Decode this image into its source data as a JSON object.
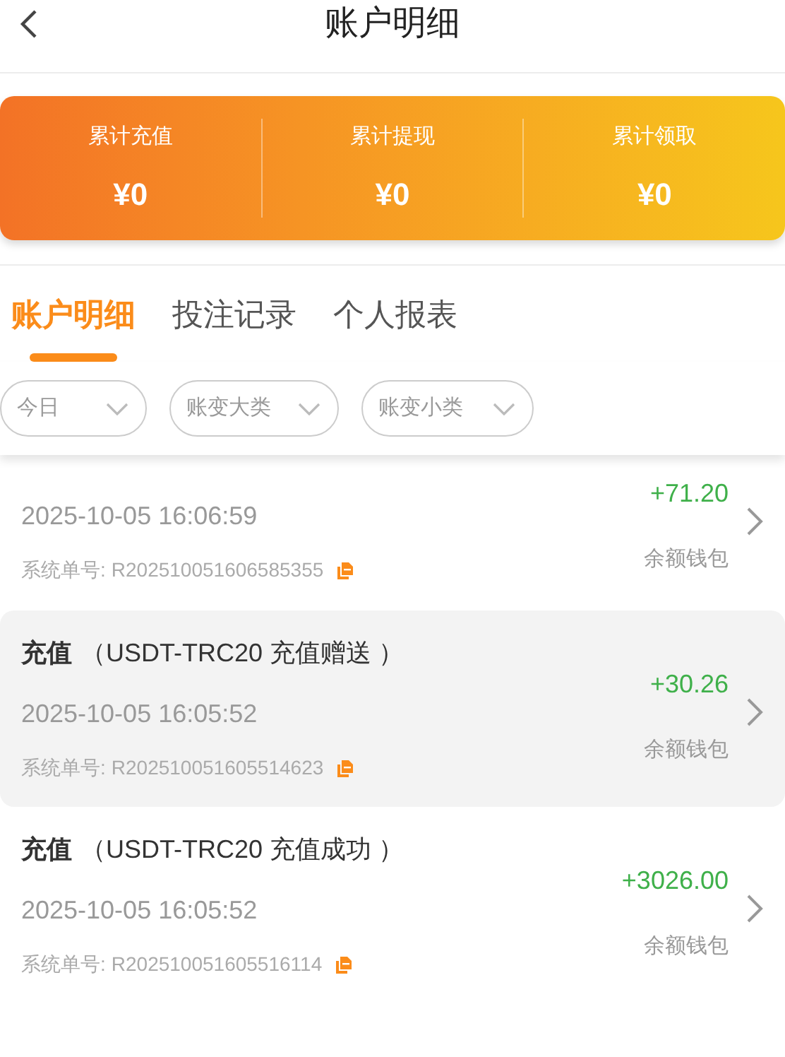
{
  "header": {
    "title": "账户明细"
  },
  "summary": [
    {
      "label": "累计充值",
      "value": "¥0"
    },
    {
      "label": "累计提现",
      "value": "¥0"
    },
    {
      "label": "累计领取",
      "value": "¥0"
    }
  ],
  "tabs": [
    {
      "label": "账户明细",
      "selected": true
    },
    {
      "label": "投注记录",
      "selected": false
    },
    {
      "label": "个人报表",
      "selected": false
    }
  ],
  "filters": [
    {
      "label": "今日"
    },
    {
      "label": "账变大类"
    },
    {
      "label": "账变小类"
    }
  ],
  "records": [
    {
      "date": "2025-10-05 16:06:59",
      "order_label": "系统单号:",
      "order_no": "R202510051606585355",
      "amount": "+71.20",
      "wallet": "余额钱包",
      "selected": false
    },
    {
      "type": "充值",
      "detail": "（USDT-TRC20 充值赠送 ）",
      "date": "2025-10-05 16:05:52",
      "order_label": "系统单号:",
      "order_no": "R202510051605514623",
      "amount": "+30.26",
      "wallet": "余额钱包",
      "selected": true
    },
    {
      "type": "充值",
      "detail": "（USDT-TRC20 充值成功 ）",
      "date": "2025-10-05 16:05:52",
      "order_label": "系统单号:",
      "order_no": "R202510051605516114",
      "amount": "+3026.00",
      "wallet": "余额钱包",
      "selected": false
    }
  ]
}
